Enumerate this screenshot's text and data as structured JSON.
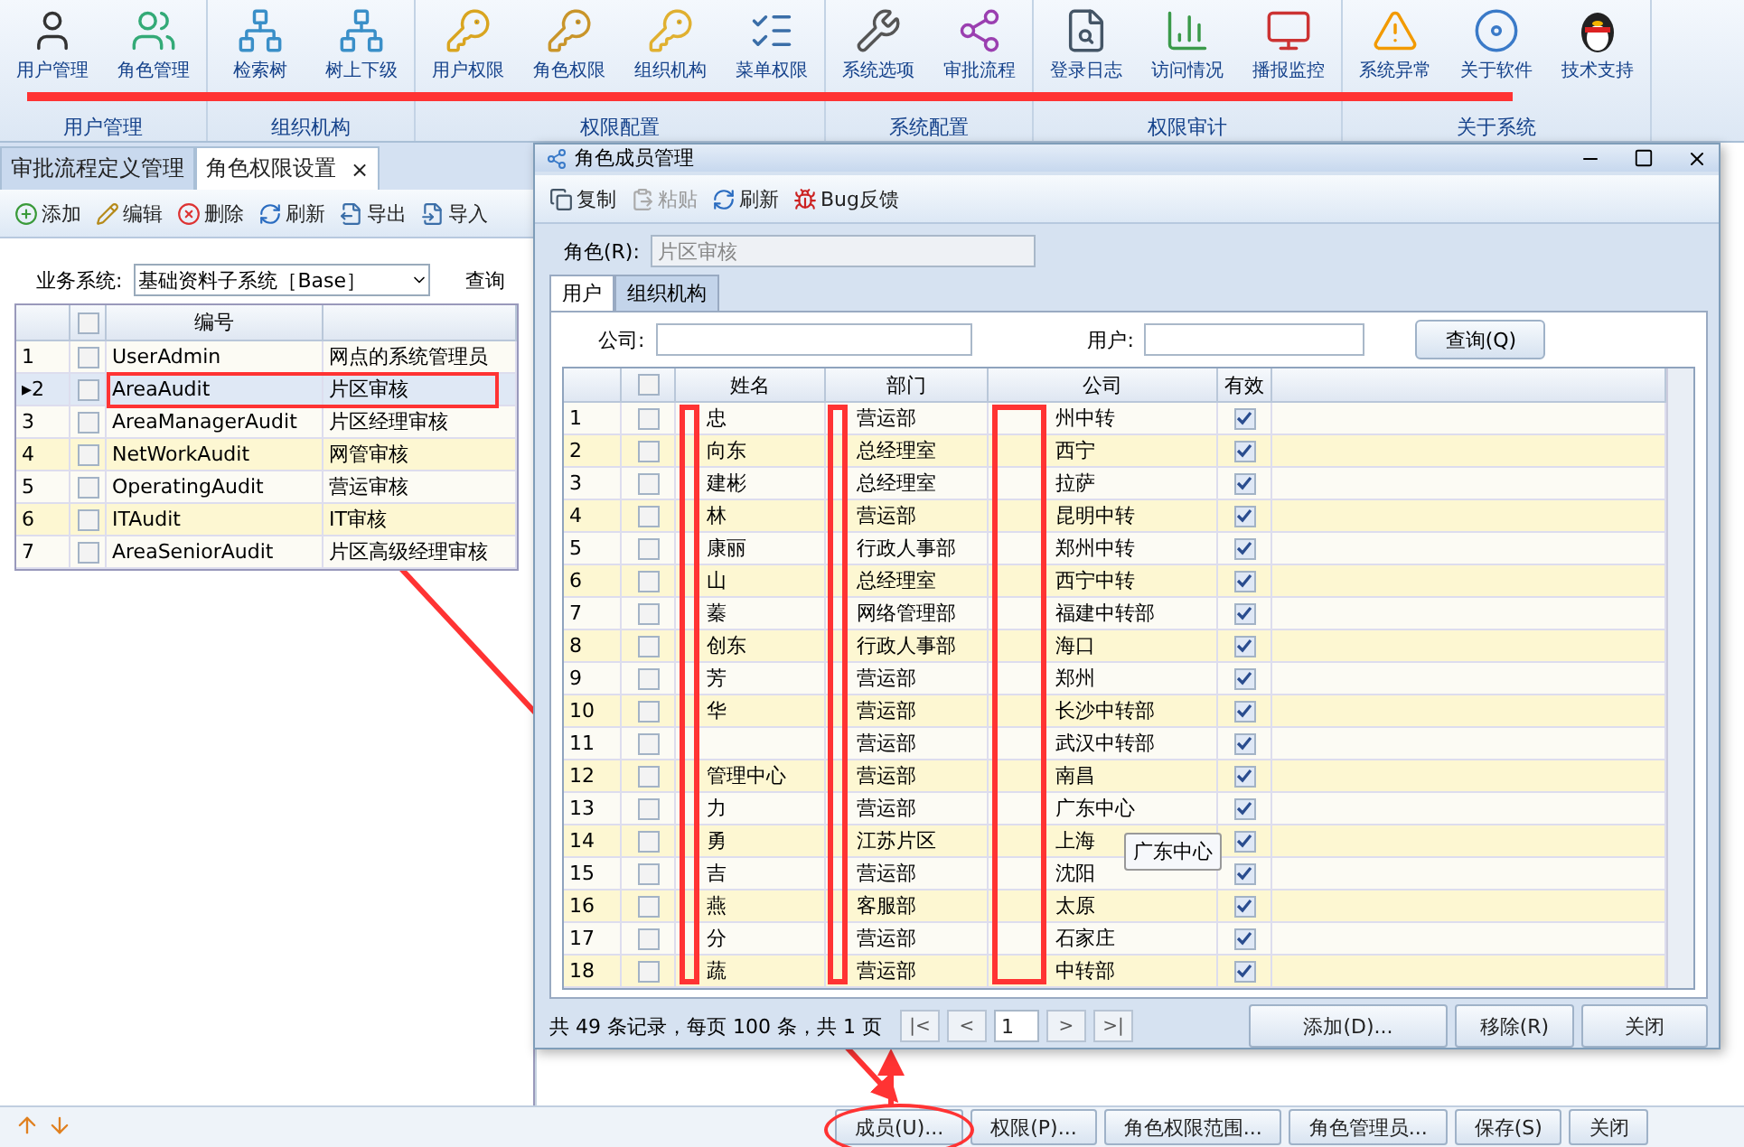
{
  "ribbon": {
    "groups": [
      {
        "label": "用户管理",
        "items": [
          {
            "label": "用户管理"
          },
          {
            "label": "角色管理"
          }
        ]
      },
      {
        "label": "组织机构",
        "items": [
          {
            "label": "检索树"
          },
          {
            "label": "树上下级"
          }
        ]
      },
      {
        "label": "权限配置",
        "items": [
          {
            "label": "用户权限"
          },
          {
            "label": "角色权限"
          },
          {
            "label": "组织机构"
          },
          {
            "label": "菜单权限"
          }
        ]
      },
      {
        "label": "系统配置",
        "items": [
          {
            "label": "系统选项"
          },
          {
            "label": "审批流程"
          }
        ]
      },
      {
        "label": "权限审计",
        "items": [
          {
            "label": "登录日志"
          },
          {
            "label": "访问情况"
          },
          {
            "label": "播报监控"
          }
        ]
      },
      {
        "label": "关于系统",
        "items": [
          {
            "label": "系统异常"
          },
          {
            "label": "关于软件"
          },
          {
            "label": "技术支持"
          }
        ]
      }
    ]
  },
  "tabs": [
    {
      "label": "审批流程定义管理",
      "selected": false
    },
    {
      "label": "角色权限设置",
      "selected": true,
      "close": "×"
    }
  ],
  "toolbar": [
    {
      "label": "添加"
    },
    {
      "label": "编辑"
    },
    {
      "label": "删除"
    },
    {
      "label": "刷新"
    },
    {
      "label": "导出"
    },
    {
      "label": "导入"
    }
  ],
  "system_filter": {
    "label": "业务系统:",
    "value": "基础资料子系统［Base］",
    "query_label": "查询"
  },
  "roles_table": {
    "columns": [
      "编号"
    ],
    "header_checked": false,
    "rows": [
      {
        "num": "1",
        "code": "UserAdmin",
        "name": "网点的系统管理员",
        "selected": false,
        "highlight": false,
        "checked": false
      },
      {
        "num": "2",
        "marker": "▸",
        "code": "AreaAudit",
        "name": "片区审核",
        "selected": true,
        "highlight": false,
        "checked": false
      },
      {
        "num": "3",
        "code": "AreaManagerAudit",
        "name": "片区经理审核",
        "selected": false,
        "highlight": false,
        "checked": false
      },
      {
        "num": "4",
        "code": "NetWorkAudit",
        "name": "网管审核",
        "selected": false,
        "highlight": true,
        "checked": false
      },
      {
        "num": "5",
        "code": "OperatingAudit",
        "name": "营运审核",
        "selected": false,
        "highlight": false,
        "checked": false
      },
      {
        "num": "6",
        "code": "ITAudit",
        "name": "IT审核",
        "selected": false,
        "highlight": true,
        "checked": false
      },
      {
        "num": "7",
        "code": "AreaSeniorAudit",
        "name": "片区高级经理审核",
        "selected": false,
        "highlight": false,
        "checked": false
      }
    ]
  },
  "dialog": {
    "title": "角色成员管理",
    "toolbar": [
      {
        "label": "复制",
        "disabled": false
      },
      {
        "label": "粘贴",
        "disabled": true
      },
      {
        "label": "刷新",
        "disabled": false
      },
      {
        "label": "Bug反馈",
        "disabled": false
      }
    ],
    "role_label": "角色(R):",
    "role_value": "片区审核",
    "tabs": [
      {
        "label": "用户",
        "selected": true
      },
      {
        "label": "组织机构",
        "selected": false
      }
    ],
    "company_label": "公司:",
    "user_label": "用户:",
    "query_button": "查询(Q)",
    "columns": [
      "姓名",
      "部门",
      "公司",
      "有效"
    ],
    "header_checked": false,
    "rows": [
      {
        "num": "1",
        "name": "忠",
        "dept": "营运部",
        "company": "州中转",
        "checked": false,
        "valid": true
      },
      {
        "num": "2",
        "name": "向东",
        "dept": "总经理室",
        "company": "西宁",
        "checked": false,
        "valid": true
      },
      {
        "num": "3",
        "name": "建彬",
        "dept": "总经理室",
        "company": "拉萨",
        "checked": false,
        "valid": true
      },
      {
        "num": "4",
        "name": "林",
        "dept": "营运部",
        "company": "昆明中转",
        "checked": false,
        "valid": true
      },
      {
        "num": "5",
        "name": "康丽",
        "dept": "行政人事部",
        "company": "郑州中转",
        "checked": false,
        "valid": true
      },
      {
        "num": "6",
        "name": "山",
        "dept": "总经理室",
        "company": "西宁中转",
        "checked": false,
        "valid": true
      },
      {
        "num": "7",
        "name": "蓁",
        "dept": "网络管理部",
        "company": "福建中转部",
        "checked": false,
        "valid": true
      },
      {
        "num": "8",
        "name": "创东",
        "dept": "行政人事部",
        "company": "海口",
        "checked": false,
        "valid": true
      },
      {
        "num": "9",
        "name": "芳",
        "dept": "营运部",
        "company": "郑州",
        "checked": false,
        "valid": true
      },
      {
        "num": "10",
        "name": "华",
        "dept": "营运部",
        "company": "长沙中转部",
        "checked": false,
        "valid": true
      },
      {
        "num": "11",
        "dept": "营运部",
        "company": "武汉中转部",
        "checked": false,
        "valid": true
      },
      {
        "num": "12",
        "name": "管理中心",
        "dept": "营运部",
        "company": "南昌",
        "checked": false,
        "valid": true
      },
      {
        "num": "13",
        "name": "力",
        "dept": "营运部",
        "company": "广东中心",
        "checked": false,
        "valid": true
      },
      {
        "num": "14",
        "name": "勇",
        "dept": "江苏片区",
        "company": "上海",
        "checked": false,
        "valid": true
      },
      {
        "num": "15",
        "name": "吉",
        "dept": "营运部",
        "company": "沈阳",
        "checked": false,
        "valid": true
      },
      {
        "num": "16",
        "name": "燕",
        "dept": "客服部",
        "company": "太原",
        "checked": false,
        "valid": true
      },
      {
        "num": "17",
        "name": "分",
        "dept": "营运部",
        "company": "石家庄",
        "checked": false,
        "valid": true
      },
      {
        "num": "18",
        "name": "蔬",
        "dept": "营运部",
        "company": "中转部",
        "checked": false,
        "valid": true
      }
    ],
    "tooltip": "广东中心",
    "pager_text": "共 49 条记录，每页 100 条，共 1 页",
    "pager_buttons": [
      "|<",
      "<",
      ">",
      ">|"
    ],
    "page": "1",
    "buttons": [
      "添加(D)...",
      "移除(R)",
      "关闭"
    ]
  },
  "bottom_buttons": [
    "成员(U)...",
    "权限(P)...",
    "角色权限范围...",
    "角色管理员...",
    "保存(S)",
    "关闭"
  ]
}
